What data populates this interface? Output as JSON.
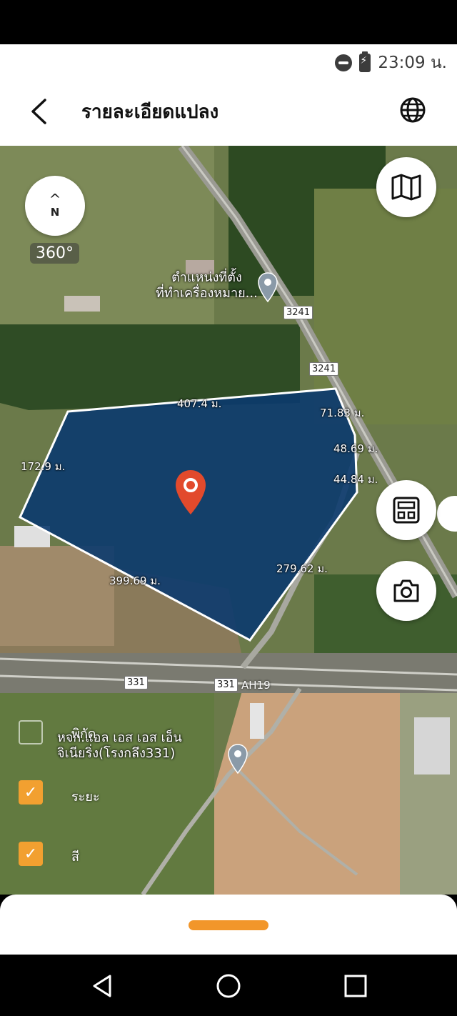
{
  "status": {
    "time": "23:09 น."
  },
  "header": {
    "title": "รายละเอียดแปลง"
  },
  "map": {
    "compass_label": "N",
    "rotation_label": "360°",
    "place_labels": [
      {
        "line1": "ตำแหน่งที่ตั้ง",
        "line2": "ที่ทำเครื่องหมาย..."
      },
      {
        "line1": "หจก.แอล เอส เอส เอ็น",
        "line2": "จิเนียริ่ง(โรงกลึง331)"
      }
    ],
    "road_shields": [
      "3241",
      "3241",
      "331",
      "331"
    ],
    "road_ah": "AH19",
    "plot_dimensions": [
      "407.4 ม.",
      "71.83 ม.",
      "48.69 ม.",
      "44.84 ม.",
      "172.9 ม.",
      "279.62 ม.",
      "399.69 ม."
    ],
    "colors": {
      "plot_fill": "#0b3a6e",
      "pin": "#e24a2c",
      "accent": "#f2962a",
      "checkbox": "#f2a030"
    }
  },
  "layers": {
    "heading": "พิกัด",
    "items": [
      {
        "label": "ระยะ",
        "checked": true
      },
      {
        "label": "สี",
        "checked": true
      }
    ]
  },
  "icons": [
    "back-icon",
    "globe-icon",
    "compass-icon",
    "map-icon",
    "calculator-icon",
    "camera-icon",
    "location-pin-icon",
    "nav-back-icon",
    "nav-home-icon",
    "nav-recents-icon"
  ]
}
